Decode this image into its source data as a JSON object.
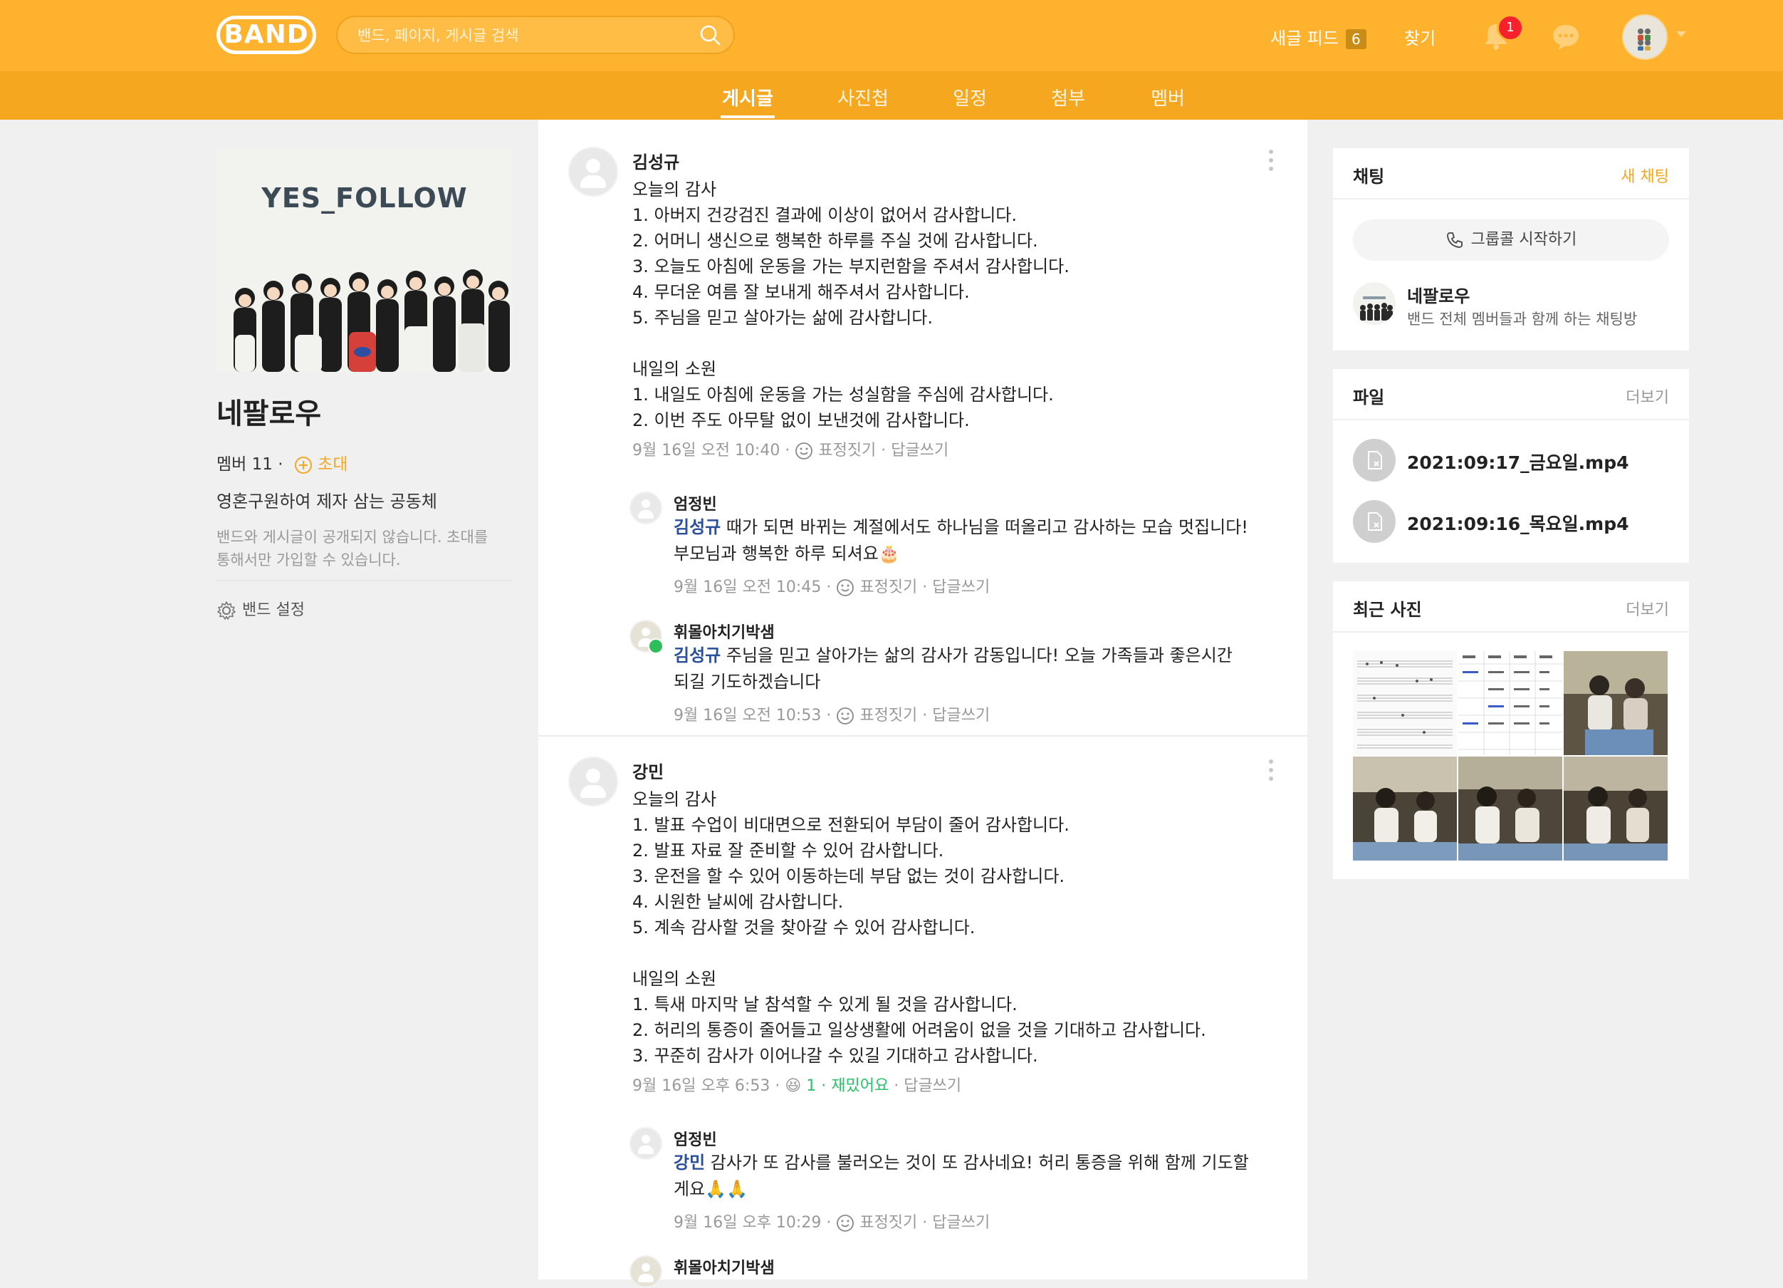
{
  "header": {
    "logo": "BAND",
    "search_placeholder": "밴드, 페이지, 게시글 검색",
    "new_feed_label": "새글 피드",
    "new_feed_count": "6",
    "find_label": "찾기",
    "notification_count": "1"
  },
  "tabs": [
    {
      "label": "게시글",
      "active": true
    },
    {
      "label": "사진첩"
    },
    {
      "label": "일정"
    },
    {
      "label": "첨부"
    },
    {
      "label": "멤버"
    }
  ],
  "band": {
    "cover_text": "YES_FOLLOW",
    "name": "네팔로우",
    "member_label": "멤버 11 ·",
    "invite_label": "초대",
    "description": "영혼구원하여 제자 삼는 공동체",
    "privacy_line1": "밴드와 게시글이 공개되지 않습니다. 초대를",
    "privacy_line2": "통해서만 가입할 수 있습니다.",
    "settings_label": "밴드 설정"
  },
  "posts": [
    {
      "author": "김성규",
      "lines": [
        "오늘의 감사",
        "1. 아버지 건강검진 결과에 이상이 없어서 감사합니다.",
        "2. 어머니 생신으로 행복한 하루를 주실 것에 감사합니다.",
        "3. 오늘도 아침에 운동을 가는 부지런함을 주셔서 감사합니다.",
        "4. 무더운 여름 잘 보내게 해주셔서 감사합니다.",
        "5. 주님을 믿고 살아가는 삶에 감사합니다.",
        "",
        "내일의 소원",
        "1. 내일도 아침에 운동을 가는 성실함을 주심에 감사합니다.",
        "2. 이번 주도 아무탈 없이 보낸것에 감사합니다."
      ],
      "time": "9월 16일 오전 10:40",
      "reaction": "표정짓기",
      "reply": "답글쓰기",
      "comments": [
        {
          "author": "엄정빈",
          "mention": "김성규",
          "text1": " 때가 되면 바뀌는 계절에서도 하나님을 떠올리고 감사하는 모습 멋집니다!",
          "text2": "부모님과 행복한 하루 되셔요",
          "emoji": "🎂",
          "time": "9월 16일 오전 10:45",
          "reaction": "표정짓기",
          "reply": "답글쓰기"
        },
        {
          "author": "휘몰아치기박샘",
          "mention": "김성규",
          "text1": " 주님을 믿고 살아가는 삶의 감사가 감동입니다! 오늘 가족들과 좋은시간",
          "text2": "되길 기도하겠습니다",
          "time": "9월 16일 오전 10:53",
          "reaction": "표정짓기",
          "reply": "답글쓰기"
        }
      ]
    },
    {
      "author": "강민",
      "lines": [
        "오늘의 감사",
        "1. 발표 수업이 비대면으로 전환되어 부담이 줄어 감사합니다.",
        "2. 발표 자료 잘 준비할 수 있어 감사합니다.",
        "3. 운전을 할 수 있어 이동하는데 부담 없는 것이 감사합니다.",
        "4. 시원한 날씨에 감사합니다.",
        "5. 계속 감사할 것을 찾아갈 수 있어 감사합니다.",
        "",
        "내일의 소원",
        "1. 특새 마지막 날 참석할 수 있게 될 것을 감사합니다.",
        "2. 허리의 통증이 줄어들고 일상생활에 어려움이 없을 것을 기대하고 감사합니다.",
        "3. 꾸준히 감사가 이어나갈 수 있길 기대하고 감사합니다."
      ],
      "time": "9월 16일 오후 6:53",
      "reaction_emoji": "😆",
      "reaction_count": "1",
      "reaction_label": "재밌어요",
      "reply": "답글쓰기",
      "comments": [
        {
          "author": "엄정빈",
          "mention": "강민",
          "text1": " 감사가 또 감사를 불러오는 것이 또 감사네요! 허리 통증을 위해 함께 기도할",
          "text2": "게요",
          "emoji": "🙏🙏",
          "time": "9월 16일 오후 10:29",
          "reaction": "표정짓기",
          "reply": "답글쓰기"
        },
        {
          "author": "휘몰아치기박샘"
        }
      ]
    }
  ],
  "sidebar": {
    "chat": {
      "title": "채팅",
      "new_chat": "새 채팅",
      "group_call": "그룹콜 시작하기",
      "room_name": "네팔로우",
      "room_desc": "밴드 전체 멤버들과 함께 하는 채팅방"
    },
    "files": {
      "title": "파일",
      "more": "더보기",
      "items": [
        "2021:09:17_금요일.mp4",
        "2021:09:16_목요일.mp4"
      ]
    },
    "photos": {
      "title": "최근 사진",
      "more": "더보기"
    }
  },
  "colors": {
    "brand": "#ffb22d",
    "tabbar": "#f5a720",
    "mention": "#2a4f9a",
    "reaction_green": "#2bc26c"
  }
}
